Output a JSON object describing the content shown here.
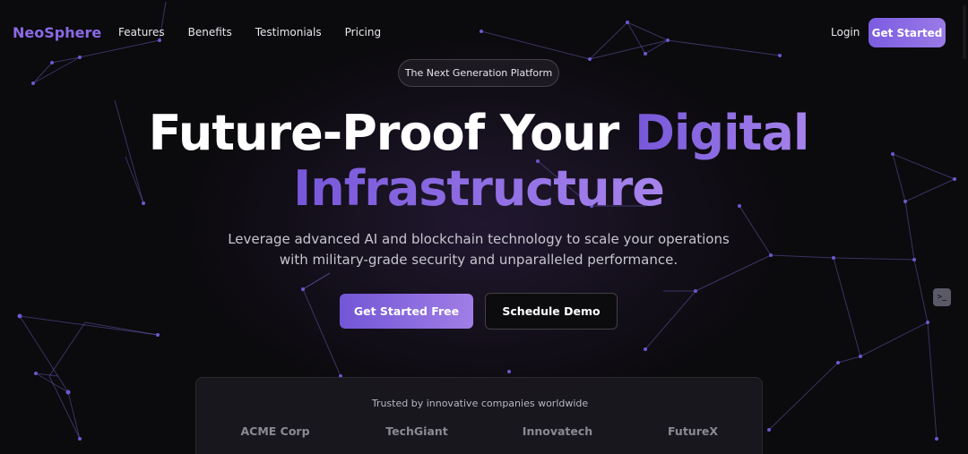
{
  "nav": {
    "brand": "NeoSphere",
    "links": [
      "Features",
      "Benefits",
      "Testimonials",
      "Pricing"
    ],
    "login": "Login",
    "cta": "Get Started"
  },
  "hero": {
    "badge": "The Next Generation Platform",
    "title_plain": "Future-Proof Your",
    "title_accent_1": "Digital",
    "title_accent_2": "Infrastructure",
    "subtitle_line1": "Leverage advanced AI and blockchain technology to scale your operations",
    "subtitle_line2": "with military-grade security and unparalleled performance.",
    "primary_cta": "Get Started Free",
    "secondary_cta": "Schedule Demo"
  },
  "trusted": {
    "title": "Trusted by innovative companies worldwide",
    "companies": [
      "ACME Corp",
      "TechGiant",
      "Innovatech",
      "FutureX"
    ]
  },
  "colors": {
    "accent": "#8b6ae6",
    "background": "#0b0a0d"
  },
  "icons": {
    "side_widget": "terminal-icon"
  }
}
